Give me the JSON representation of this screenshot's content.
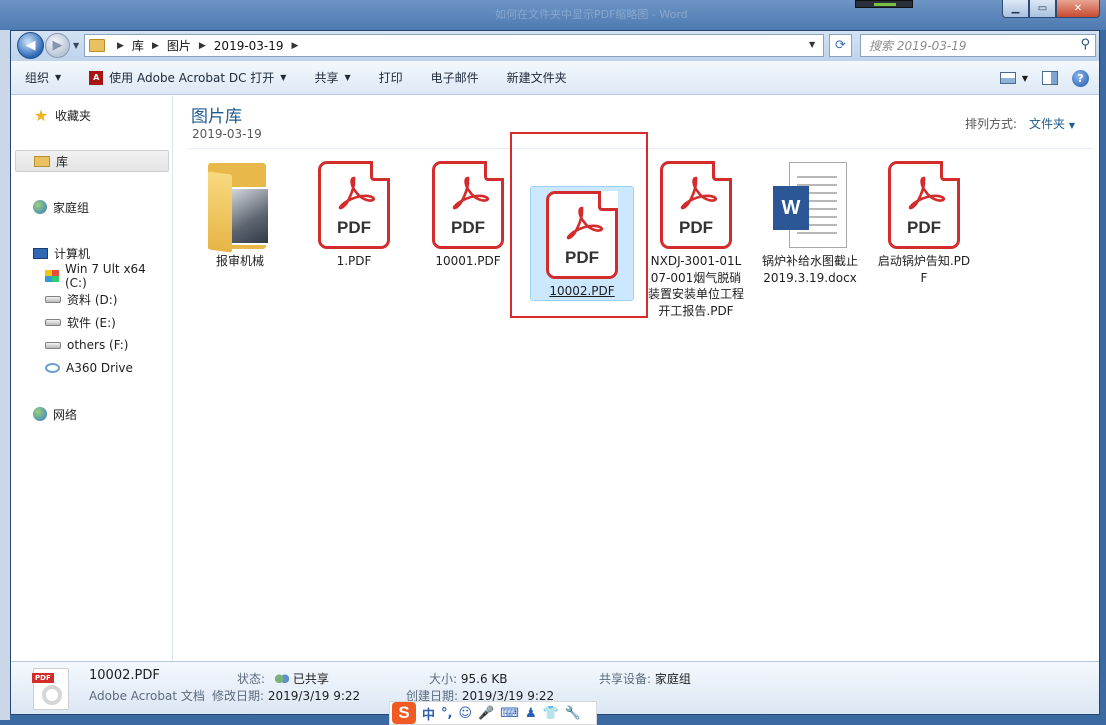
{
  "window": {
    "blur_title": "如何在文件夹中显示PDF缩略图 - Word"
  },
  "address": {
    "crumbs": [
      "库",
      "图片",
      "2019-03-19"
    ],
    "search_placeholder": "搜索 2019-03-19"
  },
  "toolbar": {
    "organize": "组织",
    "open_with": "使用 Adobe Acrobat DC 打开",
    "share": "共享",
    "print": "打印",
    "email": "电子邮件",
    "new_folder": "新建文件夹"
  },
  "nav": {
    "favorites": "收藏夹",
    "libraries": "库",
    "homegroup": "家庭组",
    "computer": "计算机",
    "drives": [
      "Win 7 Ult x64 (C:)",
      "资料 (D:)",
      "软件 (E:)",
      "others (F:)",
      "A360 Drive"
    ],
    "network": "网络"
  },
  "content": {
    "library_title": "图片库",
    "library_subtitle": "2019-03-19",
    "arrange_label": "排列方式:",
    "arrange_value": "文件夹",
    "files": [
      {
        "name": "报审机械",
        "type": "folder"
      },
      {
        "name": "1.PDF",
        "type": "pdf"
      },
      {
        "name": "10001.PDF",
        "type": "pdf"
      },
      {
        "name": "10002.PDF",
        "type": "pdf",
        "selected": true
      },
      {
        "name": "NXDJ-3001-01L07-001烟气脱硝装置安装单位工程开工报告.PDF",
        "type": "pdf"
      },
      {
        "name": "锅炉补给水图截止2019.3.19.docx",
        "type": "docx"
      },
      {
        "name": "启动锅炉告知.PDF",
        "type": "pdf"
      }
    ],
    "pdf_icon_text": "PDF",
    "word_icon_text": "W"
  },
  "details": {
    "filename": "10002.PDF",
    "filetype": "Adobe Acrobat 文档",
    "status_label": "状态:",
    "status_value": "已共享",
    "modified_label": "修改日期:",
    "modified_value": "2019/3/19 9:22",
    "size_label": "大小:",
    "size_value": "95.6 KB",
    "created_label": "创建日期:",
    "created_value": "2019/3/19 9:22",
    "shared_with_label": "共享设备:",
    "shared_with_value": "家庭组",
    "icon_tag": "PDF"
  },
  "ime": {
    "logo": "S",
    "mode": "中",
    "punct": "°,"
  },
  "colors": {
    "accent": "#1e5a8c",
    "highlight": "#d62b2b",
    "selection": "#cce8ff"
  }
}
